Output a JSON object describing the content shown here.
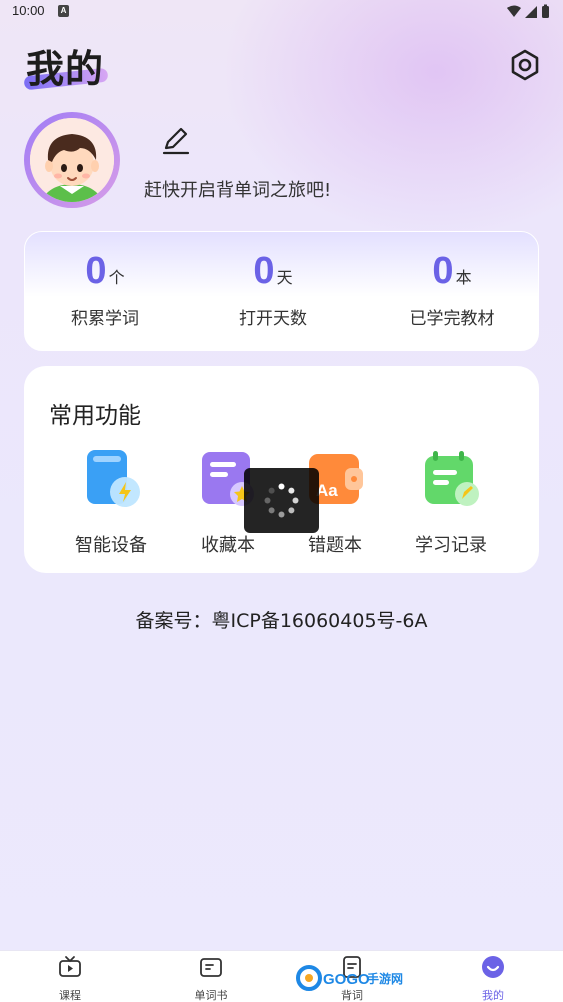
{
  "status_bar": {
    "time": "10:00",
    "notification": "A"
  },
  "header": {
    "title": "我的"
  },
  "profile": {
    "prompt": "赶快开启背单词之旅吧!"
  },
  "stats": [
    {
      "value": "0",
      "unit": "个",
      "label": "积累学词"
    },
    {
      "value": "0",
      "unit": "天",
      "label": "打开天数"
    },
    {
      "value": "0",
      "unit": "本",
      "label": "已学完教材"
    }
  ],
  "functions": {
    "title": "常用功能",
    "items": [
      {
        "label": "智能设备",
        "icon": "smart-device-icon"
      },
      {
        "label": "收藏本",
        "icon": "favorites-icon"
      },
      {
        "label": "错题本",
        "icon": "mistakes-icon"
      },
      {
        "label": "学习记录",
        "icon": "study-record-icon"
      }
    ]
  },
  "footer": {
    "icp": "备案号：粤ICP备16060405号-6A"
  },
  "nav": [
    {
      "label": "课程",
      "icon": "tv-icon"
    },
    {
      "label": "单词书",
      "icon": "book-icon"
    },
    {
      "label": "背词",
      "icon": "card-icon"
    },
    {
      "label": "我的",
      "icon": "profile-icon",
      "active": true
    }
  ],
  "watermark": {
    "text": "GOGO手游网"
  },
  "colors": {
    "accent": "#6b62e6",
    "background": "#ece9fd"
  }
}
